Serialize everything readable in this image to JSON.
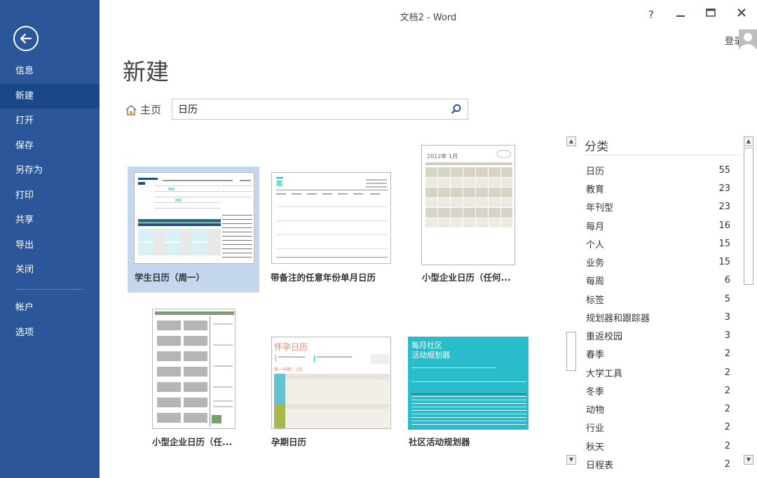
{
  "window": {
    "title": "文档2 - Word",
    "help": "?",
    "minimize": "–",
    "maximize": "□",
    "close": "✕",
    "login": "登录"
  },
  "sidebar": {
    "items": [
      {
        "label": "信息"
      },
      {
        "label": "新建"
      },
      {
        "label": "打开"
      },
      {
        "label": "保存"
      },
      {
        "label": "另存为"
      },
      {
        "label": "打印"
      },
      {
        "label": "共享"
      },
      {
        "label": "导出"
      },
      {
        "label": "关闭"
      },
      {
        "label": "帐户"
      },
      {
        "label": "选项"
      }
    ],
    "active_index": 1
  },
  "page": {
    "title": "新建",
    "home_label": "主页",
    "search_value": "日历"
  },
  "templates": [
    {
      "label": "学生日历（周一）"
    },
    {
      "label": "带备注的任意年份单月日历"
    },
    {
      "label": "小型企业日历（任何..."
    },
    {
      "label": "小型企业日历（任..."
    },
    {
      "label": "孕期日历"
    },
    {
      "label": "社区活动规划器"
    }
  ],
  "thumb_text": {
    "t2_heading": "年",
    "t3_heading": "2012年 1月",
    "t5_title": "怀孕日历",
    "t5_sub": "第一孕期：1月",
    "t6_title1": "每月社区",
    "t6_title2": "活动规划器"
  },
  "categories": {
    "title": "分类",
    "items": [
      {
        "name": "日历",
        "count": "55"
      },
      {
        "name": "教育",
        "count": "23"
      },
      {
        "name": "年刊型",
        "count": "23"
      },
      {
        "name": "每月",
        "count": "16"
      },
      {
        "name": "个人",
        "count": "15"
      },
      {
        "name": "业务",
        "count": "15"
      },
      {
        "name": "每周",
        "count": "6"
      },
      {
        "name": "标签",
        "count": "5"
      },
      {
        "name": "规划器和跟踪器",
        "count": "3"
      },
      {
        "name": "重返校园",
        "count": "3"
      },
      {
        "name": "春季",
        "count": "2"
      },
      {
        "name": "大学工具",
        "count": "2"
      },
      {
        "name": "冬季",
        "count": "2"
      },
      {
        "name": "动物",
        "count": "2"
      },
      {
        "name": "行业",
        "count": "2"
      },
      {
        "name": "秋天",
        "count": "2"
      },
      {
        "name": "日程表",
        "count": "2"
      }
    ]
  },
  "colors": {
    "sidebar": "#2b579a",
    "sidebar_active": "#19478a",
    "selected_tile": "#c5d6ef",
    "teal": "#2bbccc",
    "coral": "#f0866b",
    "green": "#7a9e6d"
  }
}
